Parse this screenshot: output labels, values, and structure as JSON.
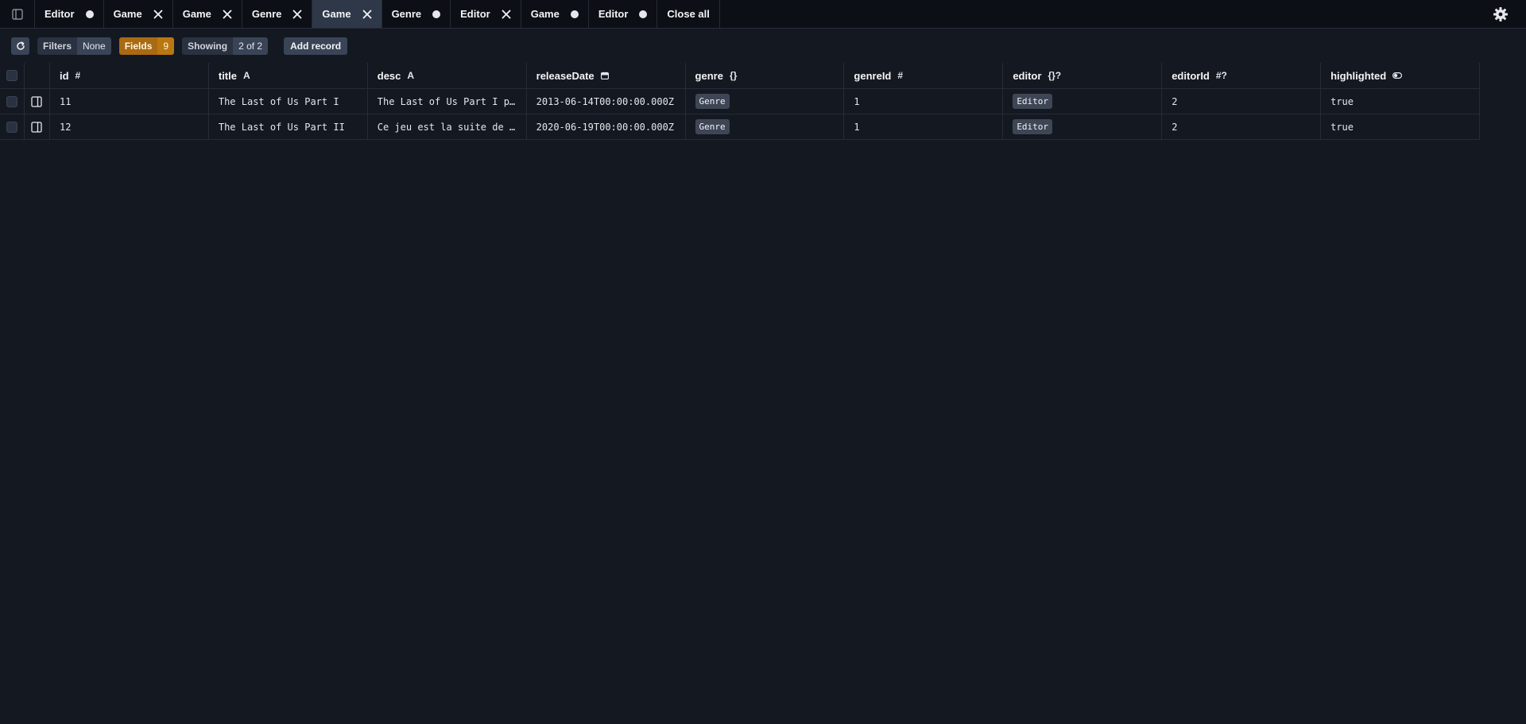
{
  "tabs": [
    {
      "label": "Editor",
      "state": "dot",
      "active": false
    },
    {
      "label": "Game",
      "state": "close",
      "active": false
    },
    {
      "label": "Game",
      "state": "close",
      "active": false
    },
    {
      "label": "Genre",
      "state": "close",
      "active": false
    },
    {
      "label": "Game",
      "state": "close",
      "active": true
    },
    {
      "label": "Genre",
      "state": "dot",
      "active": false
    },
    {
      "label": "Editor",
      "state": "close",
      "active": false
    },
    {
      "label": "Game",
      "state": "dot",
      "active": false
    },
    {
      "label": "Editor",
      "state": "dot",
      "active": false
    }
  ],
  "close_all_label": "Close all",
  "toolbar": {
    "filters_label": "Filters",
    "filters_value": "None",
    "fields_label": "Fields",
    "fields_value": "9",
    "showing_label": "Showing",
    "showing_value": "2 of 2",
    "add_record_label": "Add record"
  },
  "columns": [
    {
      "name": "id",
      "type": "#"
    },
    {
      "name": "title",
      "type": "A"
    },
    {
      "name": "desc",
      "type": "A"
    },
    {
      "name": "releaseDate",
      "type": "calendar-icon"
    },
    {
      "name": "genre",
      "type": "{}"
    },
    {
      "name": "genreId",
      "type": "#"
    },
    {
      "name": "editor",
      "type": "{}?"
    },
    {
      "name": "editorId",
      "type": "#?"
    },
    {
      "name": "highlighted",
      "type": "toggle-icon"
    }
  ],
  "rows": [
    {
      "id": "11",
      "title": "The Last of Us Part I",
      "desc": "The Last of Us Part I p…",
      "releaseDate": "2013-06-14T00:00:00.000Z",
      "genre": "Genre",
      "genreId": "1",
      "editor": "Editor",
      "editorId": "2",
      "highlighted": "true"
    },
    {
      "id": "12",
      "title": "The Last of Us Part II",
      "desc": "Ce jeu est la suite de …",
      "releaseDate": "2020-06-19T00:00:00.000Z",
      "genre": "Genre",
      "genreId": "1",
      "editor": "Editor",
      "editorId": "2",
      "highlighted": "true"
    }
  ],
  "colors": {
    "background": "#141821",
    "tabbar": "#0c0f15",
    "active_tab": "#2f3848",
    "fields_accent": "#b9770f",
    "tag": "#3e4656"
  }
}
